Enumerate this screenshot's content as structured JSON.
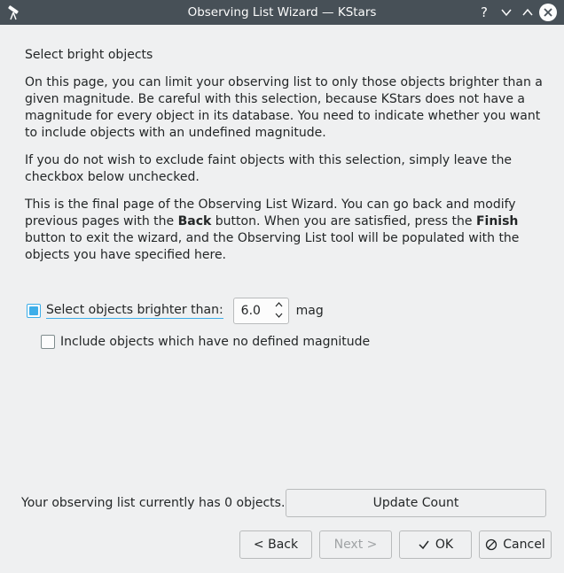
{
  "window": {
    "title": "Observing List Wizard — KStars",
    "help_glyph": "?",
    "minimize_glyph": "∨",
    "maximize_glyph": "∧",
    "close_glyph": "✕"
  },
  "page": {
    "heading": "Select bright objects",
    "para1": "On this page, you can limit your observing list to only those objects brighter than a given magnitude. Be careful with this selection, because KStars does not have a magnitude for every object in its database. You need to indicate whether you want to include objects with an undefined magnitude.",
    "para2": "If you do not wish to exclude faint objects with this selection, simply leave the checkbox below unchecked.",
    "para3_a": "This is the final page of the Observing List Wizard. You can go back and modify previous pages with the ",
    "para3_back": "Back",
    "para3_b": " button. When you are satisfied, press the ",
    "para3_finish": "Finish",
    "para3_c": " button to exit the wizard, and the Observing List tool will be populated with the objects you have specified here."
  },
  "magnitude": {
    "checkbox_label": "Select objects brighter than:",
    "checked": true,
    "value": "6.0",
    "unit": "mag"
  },
  "undefined_mag": {
    "label": "Include objects which have no defined magnitude",
    "checked": false
  },
  "status": {
    "text": "Your observing list currently has 0 objects."
  },
  "buttons": {
    "update": "Update Count",
    "back": "< Back",
    "next": "Next >",
    "ok": "OK",
    "cancel": "Cancel"
  },
  "icons": {
    "ok": "checkmark-icon",
    "cancel": "cancel-circle-icon",
    "app": "telescope-icon"
  },
  "colors": {
    "titlebar": "#475057",
    "accent": "#3daee9",
    "background": "#eff0f1"
  }
}
